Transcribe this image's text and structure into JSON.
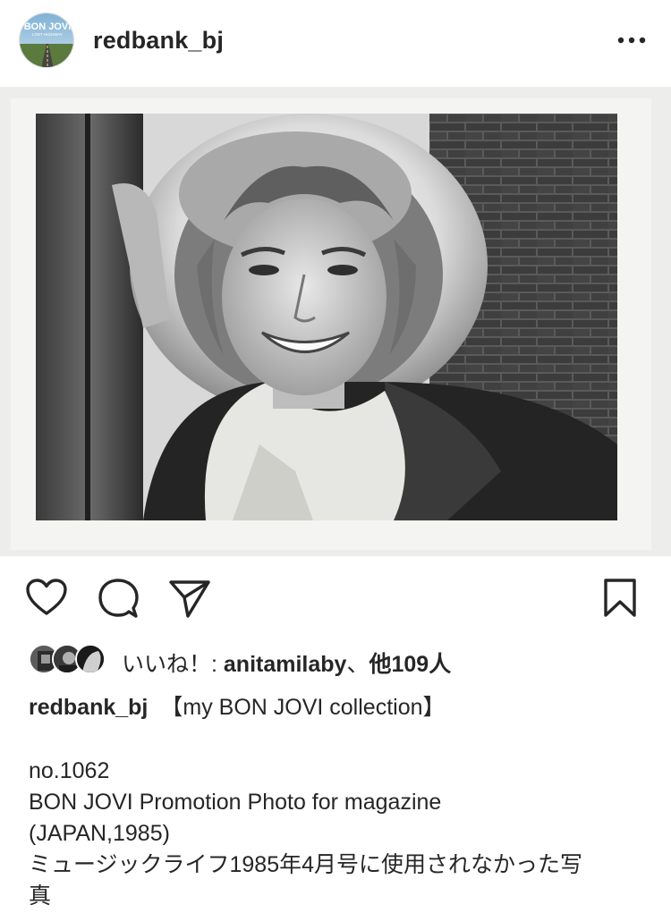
{
  "header": {
    "username": "redbank_bj",
    "avatar_icon": "album-cover-avatar",
    "avatar_text": "BON JOVI",
    "avatar_subtext": "LOST HIGHWAY",
    "more_icon": "more-horizontal-icon"
  },
  "post": {
    "image_icon": "promotion-photo"
  },
  "actions": {
    "like_icon": "heart-icon",
    "comment_icon": "comment-icon",
    "share_icon": "send-icon",
    "save_icon": "bookmark-icon"
  },
  "likes": {
    "prefix": "いいね！: ",
    "user": "anitamilaby",
    "separator": "、",
    "others": "他109人"
  },
  "caption": {
    "username": "redbank_bj",
    "title": "【my BON JOVI collection】",
    "lines": [
      "no.1062",
      "BON JOVI Promotion Photo for magazine",
      "(JAPAN,1985)",
      "ミュージックライフ1985年4月号に使用されなかった写",
      "真"
    ]
  },
  "colors": {
    "text": "#262626",
    "background": "#ffffff",
    "divider": "#dbdbdb"
  }
}
